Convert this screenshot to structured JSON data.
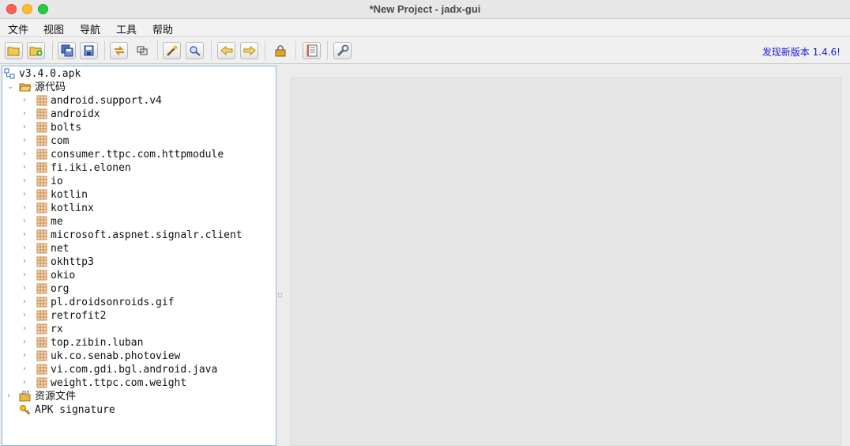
{
  "window": {
    "title": "*New Project - jadx-gui"
  },
  "menubar": {
    "items": [
      "文件",
      "视图",
      "导航",
      "工具",
      "帮助"
    ]
  },
  "toolbar": {
    "update_link": "发现新版本 1.4.6!",
    "buttons": [
      "open-file-icon",
      "add-files-icon",
      "save-all-icon",
      "export-icon",
      "sync-icon",
      "flatten-packages-icon",
      "decompile-all-icon",
      "search-icon",
      "back-icon",
      "forward-icon",
      "deobfuscation-icon",
      "log-viewer-icon",
      "preferences-icon"
    ]
  },
  "tree": {
    "root": "v3.4.0.apk",
    "sources_label": "源代码",
    "packages": [
      "android.support.v4",
      "androidx",
      "bolts",
      "com",
      "consumer.ttpc.com.httpmodule",
      "fi.iki.elonen",
      "io",
      "kotlin",
      "kotlinx",
      "me",
      "microsoft.aspnet.signalr.client",
      "net",
      "okhttp3",
      "okio",
      "org",
      "pl.droidsonroids.gif",
      "retrofit2",
      "rx",
      "top.zibin.luban",
      "uk.co.senab.photoview",
      "vi.com.gdi.bgl.android.java",
      "weight.ttpc.com.weight"
    ],
    "resources_label": "资源文件",
    "signature_label": "APK signature"
  },
  "colors": {
    "accent_link": "#1a16d8",
    "tree_border": "#8fb4d8",
    "package_icon": "#c9884a",
    "folder_icon": "#e8b84a"
  }
}
